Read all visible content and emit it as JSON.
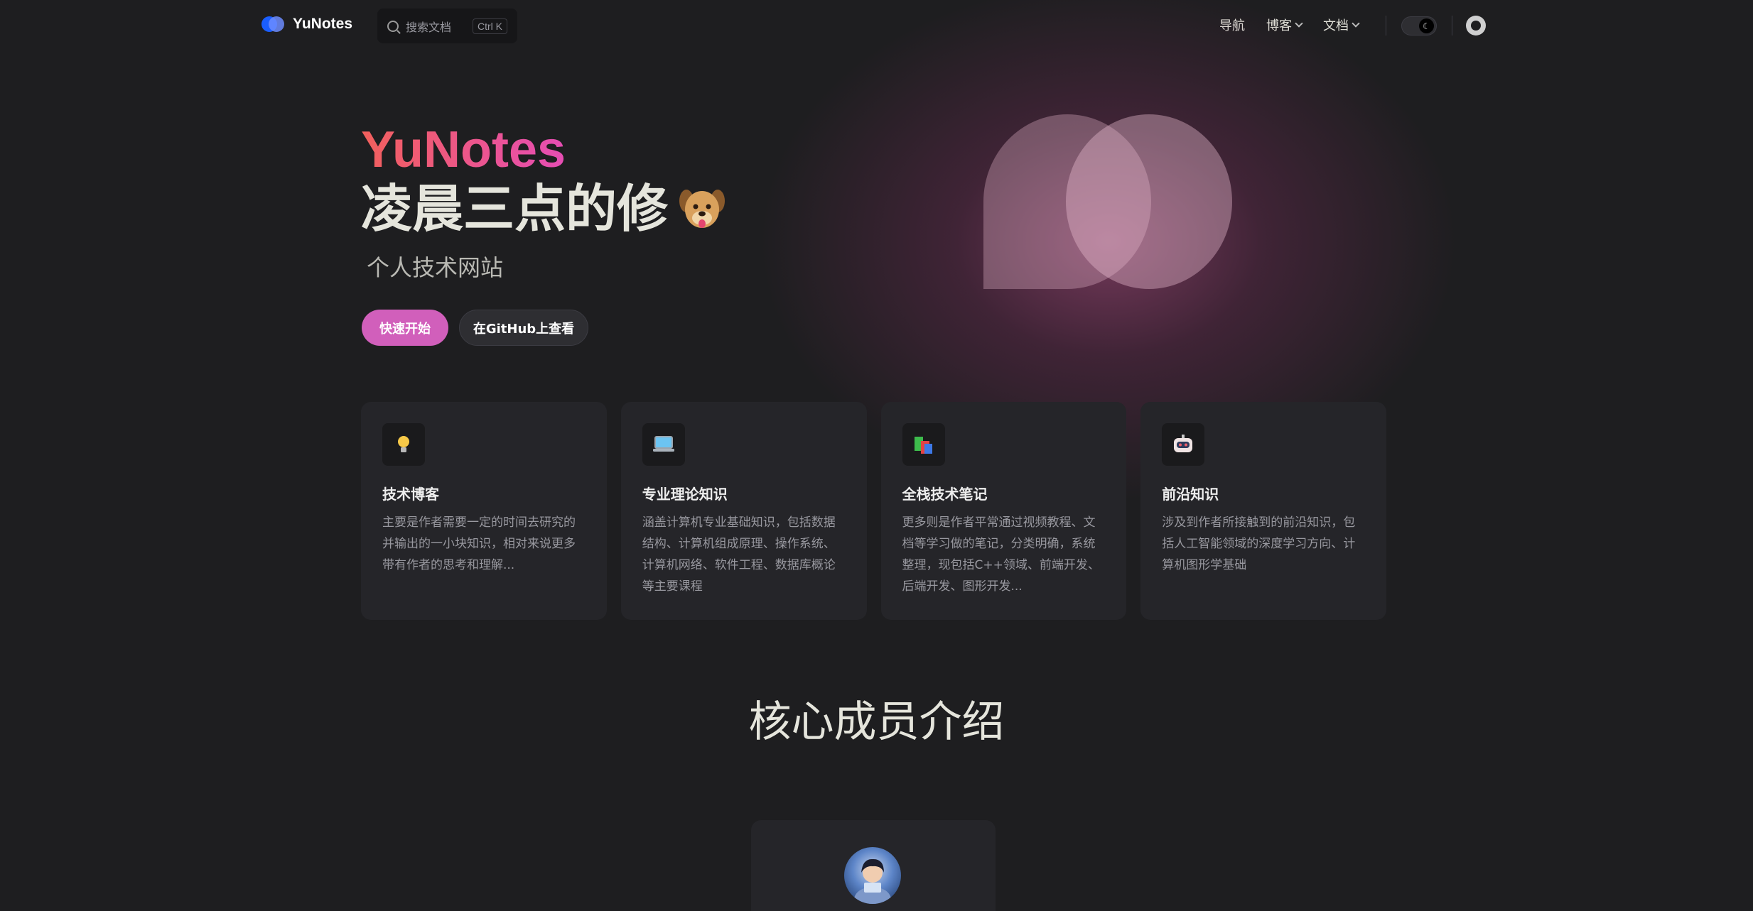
{
  "nav": {
    "logo_text": "YuNotes",
    "search_placeholder": "搜索文档",
    "search_shortcut": "Ctrl K",
    "links": [
      "导航",
      "博客",
      "文档"
    ]
  },
  "hero": {
    "name": "YuNotes",
    "text": "凌晨三点的修",
    "tagline": "个人技术网站",
    "actions": {
      "primary": "快速开始",
      "secondary": "在GitHub上查看"
    }
  },
  "features": [
    {
      "icon": "lightbulb-icon",
      "title": "技术博客",
      "details": "主要是作者需要一定的时间去研究的并输出的一小块知识，相对来说更多带有作者的思考和理解..."
    },
    {
      "icon": "laptop-icon",
      "title": "专业理论知识",
      "details": "涵盖计算机专业基础知识，包括数据结构、计算机组成原理、操作系统、计算机网络、软件工程、数据库概论等主要课程"
    },
    {
      "icon": "books-icon",
      "title": "全栈技术笔记",
      "details": "更多则是作者平常通过视频教程、文档等学习做的笔记，分类明确，系统整理，现包括C++领域、前端开发、后端开发、图形开发..."
    },
    {
      "icon": "robot-icon",
      "title": "前沿知识",
      "details": "涉及到作者所接触到的前沿知识，包括人工智能领域的深度学习方向、计算机图形学基础"
    }
  ],
  "core": {
    "title": "核心成员介绍"
  },
  "colors": {
    "brand": "#d15fbb",
    "bg": "#1e1e20",
    "card": "#252529"
  }
}
